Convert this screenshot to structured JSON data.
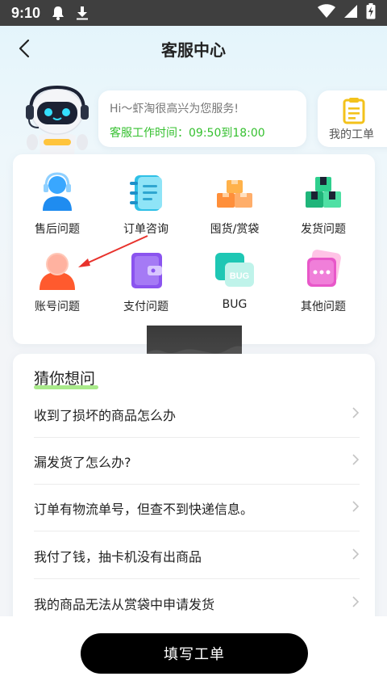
{
  "status_bar": {
    "time": "9:10",
    "icons": [
      "notification-bell-icon",
      "download-icon",
      "wifi-icon",
      "signal-icon",
      "battery-charging-icon"
    ]
  },
  "header": {
    "title": "客服中心",
    "back_icon": "back-chevron-icon"
  },
  "greeting": {
    "line1": "Hi～虾淘很高兴为您服务!",
    "line2": "客服工作时间：09:50到18:00",
    "line2_color": "#35c02f"
  },
  "my_tickets": {
    "label": "我的工单",
    "icon": "clipboard-icon"
  },
  "categories": [
    {
      "label": "售后问题",
      "icon": "agent-headset-icon"
    },
    {
      "label": "订单咨询",
      "icon": "notebook-icon"
    },
    {
      "label": "囤货/赏袋",
      "icon": "boxes-stack-icon"
    },
    {
      "label": "发货问题",
      "icon": "gift-boxes-icon"
    },
    {
      "label": "账号问题",
      "icon": "user-account-icon"
    },
    {
      "label": "支付问题",
      "icon": "wallet-icon"
    },
    {
      "label": "BUG",
      "icon": "bug-card-icon"
    },
    {
      "label": "其他问题",
      "icon": "chat-bubble-icon"
    }
  ],
  "faq": {
    "title": "猜你想问",
    "items": [
      "收到了损坏的商品怎么办",
      "漏发货了怎么办?",
      "订单有物流单号，但查不到快递信息。",
      "我付了钱，抽卡机没有出商品",
      "我的商品无法从赏袋中申请发货"
    ]
  },
  "submit_button": "填写工单",
  "colors": {
    "accent_green": "#35c02f",
    "button_bg": "#000000",
    "arrow_red": "#e8322c"
  }
}
